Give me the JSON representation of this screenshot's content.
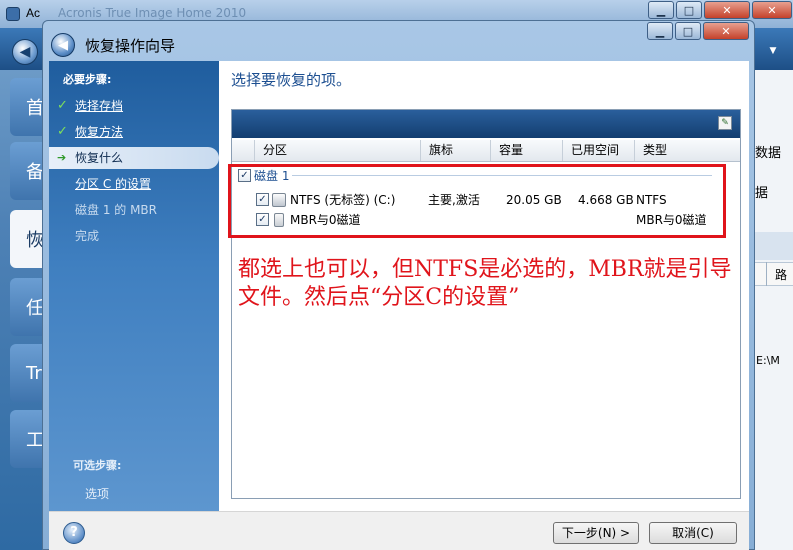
{
  "background_app": {
    "title": "Ac",
    "title_faded": "Acronis True Image Home 2010",
    "nav_items": [
      "首",
      "备",
      "恢",
      "任",
      "Tr",
      "工"
    ],
    "right_text": [
      "数据",
      "据",
      "路",
      "E:\\M"
    ]
  },
  "dialog": {
    "title": "恢复操作向导",
    "steps_required_label": "必要步骤:",
    "steps": [
      {
        "label": "选择存档",
        "state": "done"
      },
      {
        "label": "恢复方法",
        "state": "done"
      },
      {
        "label": "恢复什么",
        "state": "current"
      },
      {
        "label": "分区 C 的设置",
        "state": "link"
      },
      {
        "label": "磁盘 1 的 MBR",
        "state": "pending"
      },
      {
        "label": "完成",
        "state": "pending"
      }
    ],
    "steps_optional_label": "可选步骤:",
    "steps_options": "选项",
    "main_title": "选择要恢复的项。",
    "columns": [
      "分区",
      "旗标",
      "容量",
      "已用空间",
      "类型"
    ],
    "group": {
      "label": "磁盘 1",
      "checked": true
    },
    "rows": [
      {
        "name": "NTFS (无标签) (C:)",
        "flags": "主要,激活",
        "capacity": "20.05 GB",
        "used": "4.668 GB",
        "type": "NTFS",
        "checked": true,
        "icon": "partition-icon"
      },
      {
        "name": "MBR与0磁道",
        "flags": "",
        "capacity": "",
        "used": "",
        "type": "MBR与0磁道",
        "checked": true,
        "icon": "disk-icon"
      }
    ],
    "annotation": "都选上也可以，但NTFS是必选的，MBR就是引导文件。然后点“分区C的设置”",
    "buttons": {
      "next": "下一步(N) >",
      "cancel": "取消(C)"
    },
    "help": "?"
  },
  "colors": {
    "accent": "#1d4f91",
    "annotation": "#e0141b"
  }
}
